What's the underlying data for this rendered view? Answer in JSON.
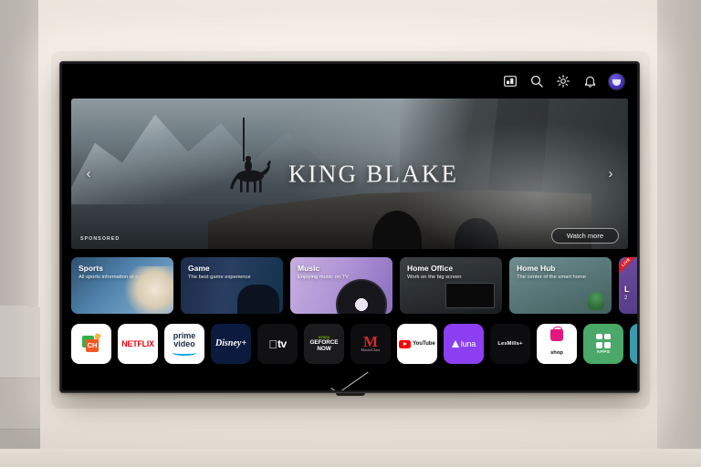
{
  "scene": {
    "description": "LG webOS Smart TV home screen mounted on a beige wall"
  },
  "topbar": {
    "icons": [
      {
        "name": "media-picture-icon",
        "glyph": "picture"
      },
      {
        "name": "search-icon",
        "glyph": "search"
      },
      {
        "name": "settings-gear-icon",
        "glyph": "gear"
      },
      {
        "name": "notification-bell-icon",
        "glyph": "bell"
      }
    ],
    "profile_label": "profile-avatar"
  },
  "hero": {
    "title": "KING BLAKE",
    "sponsored_label": "SPONSORED",
    "watch_more_label": "Watch more",
    "prev_arrow": "‹",
    "next_arrow": "›"
  },
  "cards": [
    {
      "title": "Sports",
      "subtitle": "All sports information at a glance",
      "badge": ""
    },
    {
      "title": "Game",
      "subtitle": "The best game experience",
      "badge": ""
    },
    {
      "title": "Music",
      "subtitle": "Enjoying music on TV",
      "badge": ""
    },
    {
      "title": "Home Office",
      "subtitle": "Work on the big screen",
      "badge": ""
    },
    {
      "title": "Home Hub",
      "subtitle": "The center of the smart home",
      "badge": ""
    },
    {
      "title": "L",
      "subtitle": "2",
      "badge": "LIVE"
    }
  ],
  "apps": [
    {
      "name": "lg-channels",
      "label": "CH"
    },
    {
      "name": "netflix",
      "label": "NETFLIX"
    },
    {
      "name": "prime-video",
      "label_top": "prime",
      "label_bottom": "video"
    },
    {
      "name": "disney-plus",
      "label": "Disney+"
    },
    {
      "name": "apple-tv",
      "label": "tv"
    },
    {
      "name": "geforce-now",
      "brand": "NVIDIA",
      "label_top": "GEFORCE",
      "label_bottom": "NOW"
    },
    {
      "name": "masterclass",
      "mark": "M",
      "label": "MasterClass"
    },
    {
      "name": "youtube",
      "label": "YouTube"
    },
    {
      "name": "amazon-luna",
      "label": "luna"
    },
    {
      "name": "lesmills",
      "label": "LesMills+"
    },
    {
      "name": "shop-live",
      "label": "shop"
    },
    {
      "name": "all-apps",
      "label": "APPS"
    },
    {
      "name": "screen-share",
      "label": ""
    },
    {
      "name": "more-apps",
      "label": ""
    }
  ],
  "colors": {
    "accent_purple": "#8b3ff0",
    "netflix_red": "#e50914",
    "apps_green": "#4aa868",
    "share_teal": "#3b9aad",
    "live_red": "#e01b24",
    "screen_black": "#000000",
    "wall_beige": "#efe9e1"
  }
}
